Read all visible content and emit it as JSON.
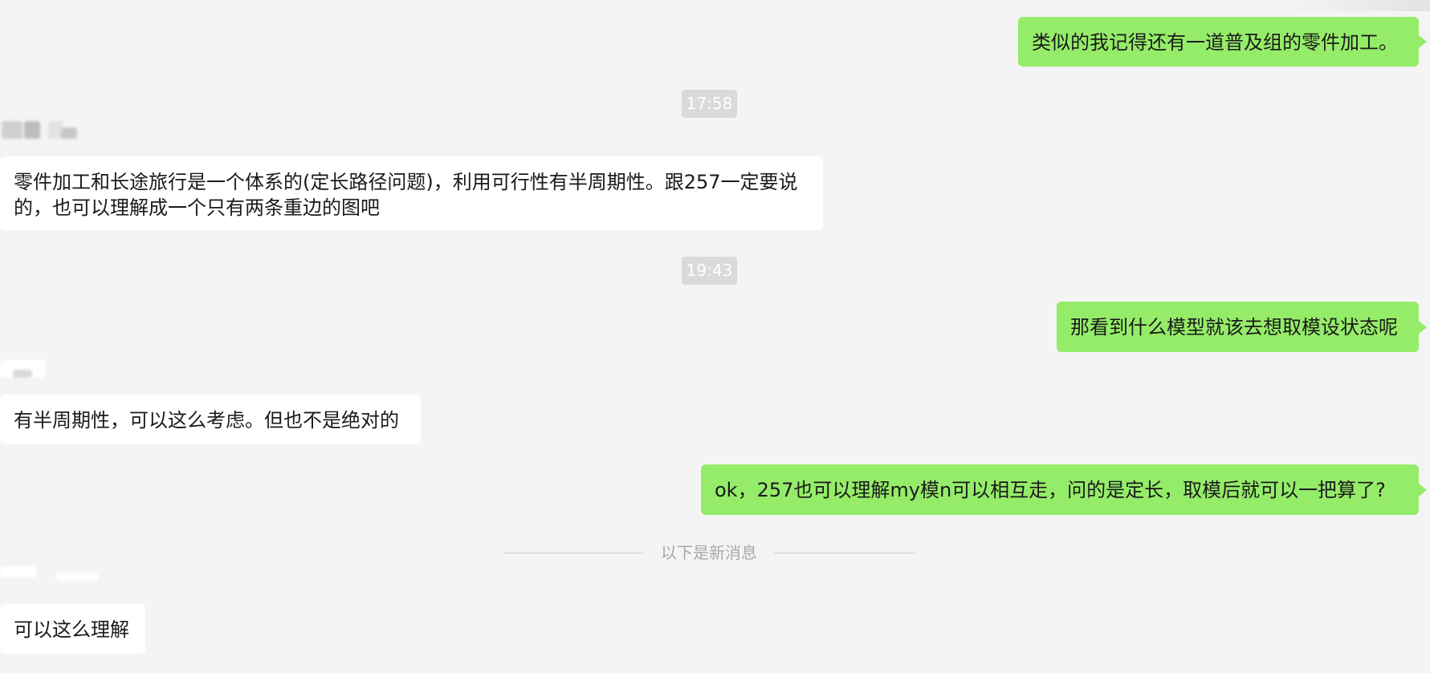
{
  "conversation": {
    "messages": [
      {
        "side": "me",
        "text": "类似的我记得还有一道普及组的零件加工。"
      },
      {
        "side": "other",
        "text": "零件加工和长途旅行是一个体系的(定长路径问题)，利用可行性有半周期性。跟257一定要说的，也可以理解成一个只有两条重边的图吧"
      },
      {
        "side": "me",
        "text": "那看到什么模型就该去想取模设状态呢"
      },
      {
        "side": "other",
        "text": "有半周期性，可以这么考虑。但也不是绝对的"
      },
      {
        "side": "me",
        "text": "ok，257也可以理解my模n可以相互走，问的是定长，取模后就可以一把算了?"
      },
      {
        "side": "other",
        "text": "可以这么理解"
      }
    ],
    "timestamps": [
      "17:58",
      "19:43"
    ],
    "new_messages_divider": "以下是新消息"
  },
  "colors": {
    "background": "#f4f4f4",
    "my_bubble": "#95ec69",
    "other_bubble": "#ffffff",
    "time_pill": "#dadada",
    "divider_text": "#a8a8a8"
  }
}
